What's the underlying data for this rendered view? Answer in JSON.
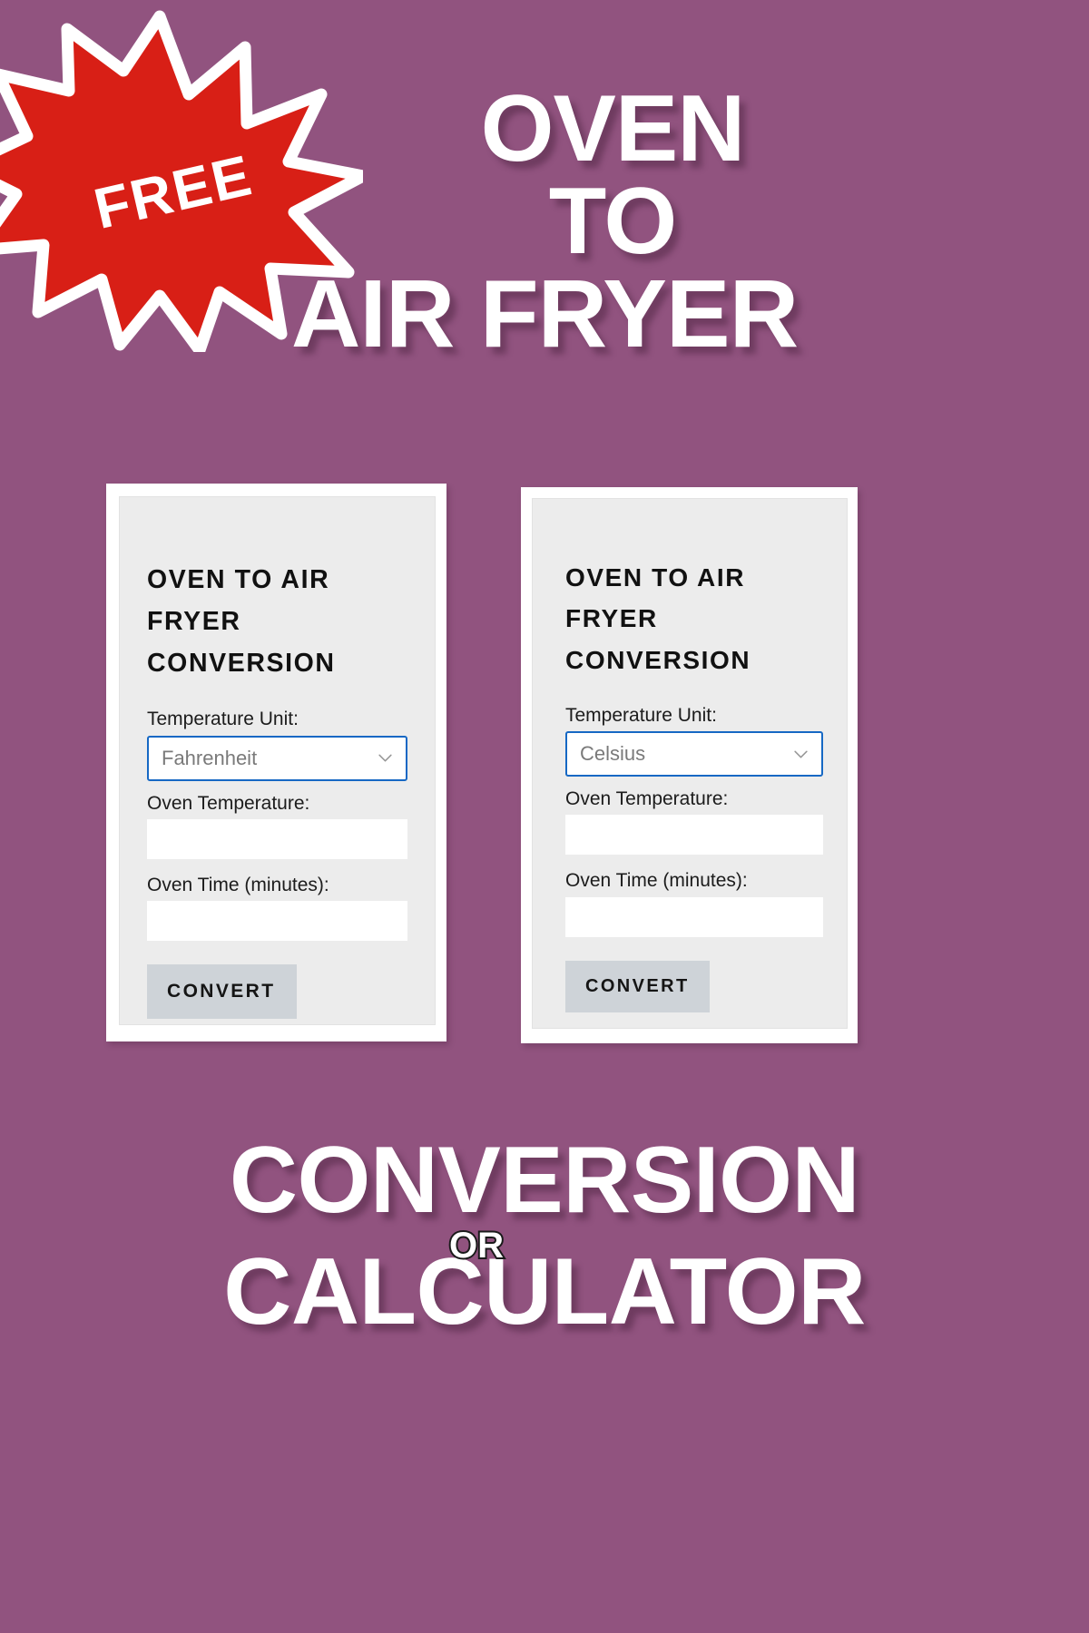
{
  "theme": {
    "background": "#91537f",
    "card_border": "#ffffff",
    "card_surface": "#ececec",
    "input_surface": "#ffffff",
    "select_focus_border": "#1668c4",
    "button_surface": "#ced3d8",
    "burst_fill": "#d81f16",
    "title_color": "#ffffff"
  },
  "badge": {
    "label": "FREE",
    "shape": "starburst-icon"
  },
  "hero": {
    "line1": "OVEN",
    "line2": "TO",
    "line3": "AIR FRYER"
  },
  "separator": {
    "label": "OR"
  },
  "cards": [
    {
      "id": "fahrenheit-card",
      "heading": "OVEN TO AIR FRYER CONVERSION",
      "unit_label": "Temperature Unit:",
      "unit_value": "Fahrenheit",
      "unit_options": [
        "Fahrenheit",
        "Celsius"
      ],
      "temp_label": "Oven Temperature:",
      "temp_value": "",
      "temp_placeholder": "",
      "time_label": "Oven Time (minutes):",
      "time_value": "",
      "time_placeholder": "",
      "button_label": "CONVERT"
    },
    {
      "id": "celsius-card",
      "heading": "OVEN TO AIR FRYER CONVERSION",
      "unit_label": "Temperature Unit:",
      "unit_value": "Celsius",
      "unit_options": [
        "Fahrenheit",
        "Celsius"
      ],
      "temp_label": "Oven Temperature:",
      "temp_value": "",
      "temp_placeholder": "",
      "time_label": "Oven Time (minutes):",
      "time_value": "",
      "time_placeholder": "",
      "button_label": "CONVERT"
    }
  ],
  "footer": {
    "line1": "CONVERSION",
    "line2": "CALCULATOR"
  }
}
